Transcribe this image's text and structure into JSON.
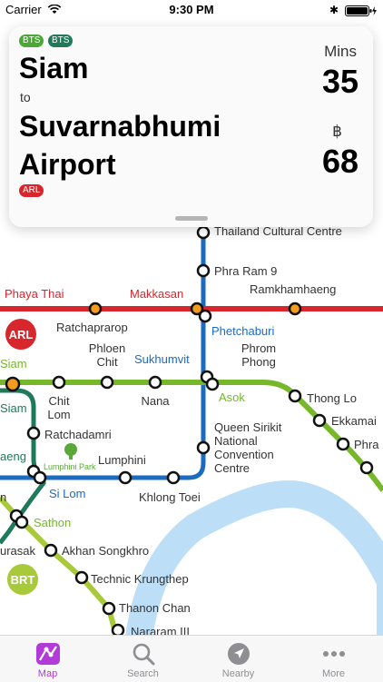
{
  "status_bar": {
    "carrier": "Carrier",
    "time": "9:30 PM",
    "bluetooth": "✱"
  },
  "route_card": {
    "origin_lines": [
      "BTS",
      "BTS"
    ],
    "origin": "Siam",
    "to_label": "to",
    "destination": "Suvarnabhumi Airport",
    "destination_line": "ARL",
    "mins_label": "Mins",
    "mins": "35",
    "currency_symbol": "฿",
    "fare": "68"
  },
  "map": {
    "lines": {
      "arl": {
        "name": "ARL",
        "color": "#d7262c"
      },
      "blue": {
        "color": "#1b6bc0"
      },
      "sukhumvit": {
        "color": "#76b82a"
      },
      "silom": {
        "color": "#1f7a5c"
      },
      "brt": {
        "name": "BRT",
        "color": "#a8c93a"
      },
      "river": {
        "color": "#bcdff7"
      }
    },
    "stations": [
      {
        "name": "Thailand Cultural Centre",
        "color": "#333333"
      },
      {
        "name": "Phra Ram 9",
        "color": "#333333"
      },
      {
        "name": "Phaya Thai",
        "color": "#d7262c"
      },
      {
        "name": "Makkasan",
        "color": "#d7262c"
      },
      {
        "name": "Ramkhamhaeng",
        "color": "#333333"
      },
      {
        "name": "Ratchaprarop",
        "color": "#333333"
      },
      {
        "name": "Phetchaburi",
        "color": "#1b6bc0"
      },
      {
        "name": "Phloen\nChit",
        "color": "#333333"
      },
      {
        "name": "Sukhumvit",
        "color": "#1b6bc0"
      },
      {
        "name": "Phrom\nPhong",
        "color": "#333333"
      },
      {
        "name": "Siam",
        "color": "#76b82a"
      },
      {
        "name": "Siam",
        "color": "#1f7a5c"
      },
      {
        "name": "Chit\nLom",
        "color": "#333333"
      },
      {
        "name": "Nana",
        "color": "#333333"
      },
      {
        "name": "Asok",
        "color": "#76b82a"
      },
      {
        "name": "Thong Lo",
        "color": "#333333"
      },
      {
        "name": "Ekkamai",
        "color": "#333333"
      },
      {
        "name": "Phra",
        "color": "#333333"
      },
      {
        "name": "Ratchadamri",
        "color": "#333333"
      },
      {
        "name": "Queen Sirikit\nNational\nConvention\nCentre",
        "color": "#333333"
      },
      {
        "name": "aeng",
        "color": "#1f7a5c"
      },
      {
        "name": "Lumphini",
        "color": "#333333"
      },
      {
        "name": "Lumphini Park",
        "color": "#5aa83a"
      },
      {
        "name": "Si Lom",
        "color": "#1b6bc0"
      },
      {
        "name": "Khlong Toei",
        "color": "#333333"
      },
      {
        "name": "n",
        "color": "#333333"
      },
      {
        "name": "Sathon",
        "color": "#76b82a"
      },
      {
        "name": "urasak",
        "color": "#333333"
      },
      {
        "name": "Akhan Songkhro",
        "color": "#333333"
      },
      {
        "name": "Technic Krungthep",
        "color": "#333333"
      },
      {
        "name": "Thanon Chan",
        "color": "#333333"
      },
      {
        "name": "Nararam III",
        "color": "#333333"
      }
    ]
  },
  "tab_bar": {
    "tabs": [
      {
        "label": "Map",
        "icon": "map-icon",
        "active": true
      },
      {
        "label": "Search",
        "icon": "search-icon",
        "active": false
      },
      {
        "label": "Nearby",
        "icon": "location-arrow-icon",
        "active": false
      },
      {
        "label": "More",
        "icon": "more-dots-icon",
        "active": false
      }
    ],
    "active_color": "#b13ad9",
    "inactive_color": "#8e8e93"
  }
}
